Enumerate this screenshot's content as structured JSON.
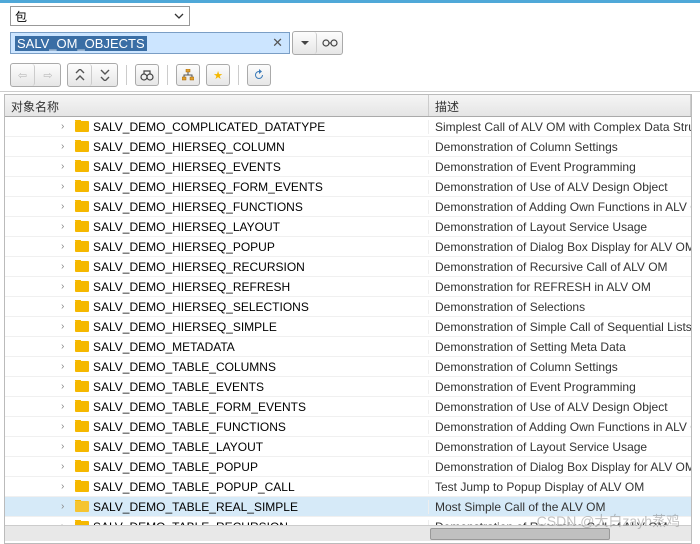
{
  "filter": {
    "dropdown_value": "包"
  },
  "search": {
    "value": "SALV_OM_OBJECTS"
  },
  "columns": {
    "name": "对象名称",
    "desc": "描述"
  },
  "rows": [
    {
      "name": "SALV_DEMO_COMPLICATED_DATATYPE",
      "desc": "Simplest Call of ALV OM with Complex Data Struc",
      "selected": false
    },
    {
      "name": "SALV_DEMO_HIERSEQ_COLUMN",
      "desc": "Demonstration of Column Settings",
      "selected": false
    },
    {
      "name": "SALV_DEMO_HIERSEQ_EVENTS",
      "desc": "Demonstration of Event Programming",
      "selected": false
    },
    {
      "name": "SALV_DEMO_HIERSEQ_FORM_EVENTS",
      "desc": "Demonstration of Use of ALV Design Object",
      "selected": false
    },
    {
      "name": "SALV_DEMO_HIERSEQ_FUNCTIONS",
      "desc": "Demonstration of Adding Own Functions in ALV O",
      "selected": false
    },
    {
      "name": "SALV_DEMO_HIERSEQ_LAYOUT",
      "desc": "Demonstration of Layout Service Usage",
      "selected": false
    },
    {
      "name": "SALV_DEMO_HIERSEQ_POPUP",
      "desc": "Demonstration of Dialog Box Display for ALV OM",
      "selected": false
    },
    {
      "name": "SALV_DEMO_HIERSEQ_RECURSION",
      "desc": "Demonstration of Recursive Call of ALV OM",
      "selected": false
    },
    {
      "name": "SALV_DEMO_HIERSEQ_REFRESH",
      "desc": "Demonstration for REFRESH in ALV OM",
      "selected": false
    },
    {
      "name": "SALV_DEMO_HIERSEQ_SELECTIONS",
      "desc": "Demonstration of Selections",
      "selected": false
    },
    {
      "name": "SALV_DEMO_HIERSEQ_SIMPLE",
      "desc": "Demonstration of Simple Call of Sequential Lists",
      "selected": false
    },
    {
      "name": "SALV_DEMO_METADATA",
      "desc": "Demonstration of Setting Meta Data",
      "selected": false
    },
    {
      "name": "SALV_DEMO_TABLE_COLUMNS",
      "desc": "Demonstration of Column Settings",
      "selected": false
    },
    {
      "name": "SALV_DEMO_TABLE_EVENTS",
      "desc": "Demonstration of Event Programming",
      "selected": false
    },
    {
      "name": "SALV_DEMO_TABLE_FORM_EVENTS",
      "desc": "Demonstration of Use of ALV Design Object",
      "selected": false
    },
    {
      "name": "SALV_DEMO_TABLE_FUNCTIONS",
      "desc": "Demonstration of Adding Own Functions in ALV O",
      "selected": false
    },
    {
      "name": "SALV_DEMO_TABLE_LAYOUT",
      "desc": "Demonstration of Layout Service Usage",
      "selected": false
    },
    {
      "name": "SALV_DEMO_TABLE_POPUP",
      "desc": "Demonstration of Dialog Box Display for ALV OM",
      "selected": false
    },
    {
      "name": "SALV_DEMO_TABLE_POPUP_CALL",
      "desc": "Test Jump to Popup Display of ALV OM",
      "selected": false
    },
    {
      "name": "SALV_DEMO_TABLE_REAL_SIMPLE",
      "desc": "Most Simple Call of the ALV OM",
      "selected": true
    },
    {
      "name": "SALV_DEMO_TABLE_RECURSION",
      "desc": "Demonstration of Recursive Call of ALV OM",
      "selected": false
    }
  ],
  "watermark": "CSDN @大白zayh蒸鸡"
}
